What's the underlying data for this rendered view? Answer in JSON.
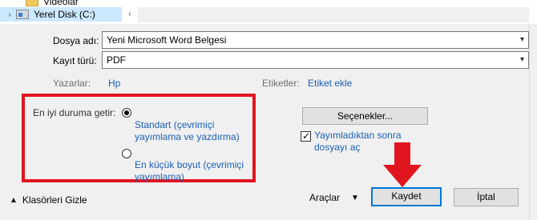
{
  "tree": {
    "items": [
      {
        "label": "Videolar"
      },
      {
        "label": "Yerel Disk (C:)"
      }
    ]
  },
  "form": {
    "filename_label": "Dosya adı:",
    "filename_value": "Yeni Microsoft Word Belgesi",
    "filetype_label": "Kayıt türü:",
    "filetype_value": "PDF",
    "authors_label": "Yazarlar:",
    "authors_value": "Hp",
    "tags_label": "Etiketler:",
    "tags_value": "Etiket ekle"
  },
  "optimize": {
    "label": "En iyi duruma getir:",
    "options": [
      {
        "text": "Standart (çevrimiçi yayımlama ve yazdırma)",
        "selected": true
      },
      {
        "text": "En küçük boyut (çevrimiçi yayımlama)",
        "selected": false
      }
    ]
  },
  "options_button": "Seçenekler...",
  "open_after_publish": {
    "label": "Yayımladıktan sonra dosyayı aç",
    "checked": true
  },
  "footer": {
    "hide_folders": "Klasörleri Gizle",
    "tools": "Araçlar",
    "save": "Kaydet",
    "cancel": "İptal"
  },
  "colors": {
    "highlight_box": "#e0151f",
    "arrow": "#e0151f",
    "link": "#1a5fb4"
  }
}
